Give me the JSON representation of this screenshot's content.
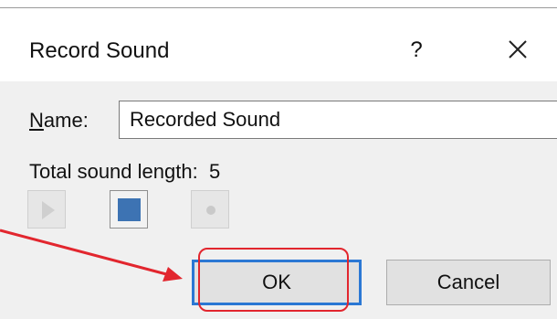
{
  "dialog": {
    "title": "Record Sound",
    "help_label": "?",
    "close_icon": "close-icon"
  },
  "name_field": {
    "label_accel": "N",
    "label_rest": "ame:",
    "value": "Recorded Sound"
  },
  "sound_length": {
    "label": "Total sound length:",
    "value": "5"
  },
  "media_controls": {
    "play_icon": "play-icon",
    "stop_icon": "stop-icon",
    "record_icon": "record-icon"
  },
  "buttons": {
    "ok": "OK",
    "cancel": "Cancel"
  },
  "colors": {
    "focus_border": "#2b78d4",
    "stop_fill": "#3d73b3",
    "annotation_red": "#e2262e"
  }
}
